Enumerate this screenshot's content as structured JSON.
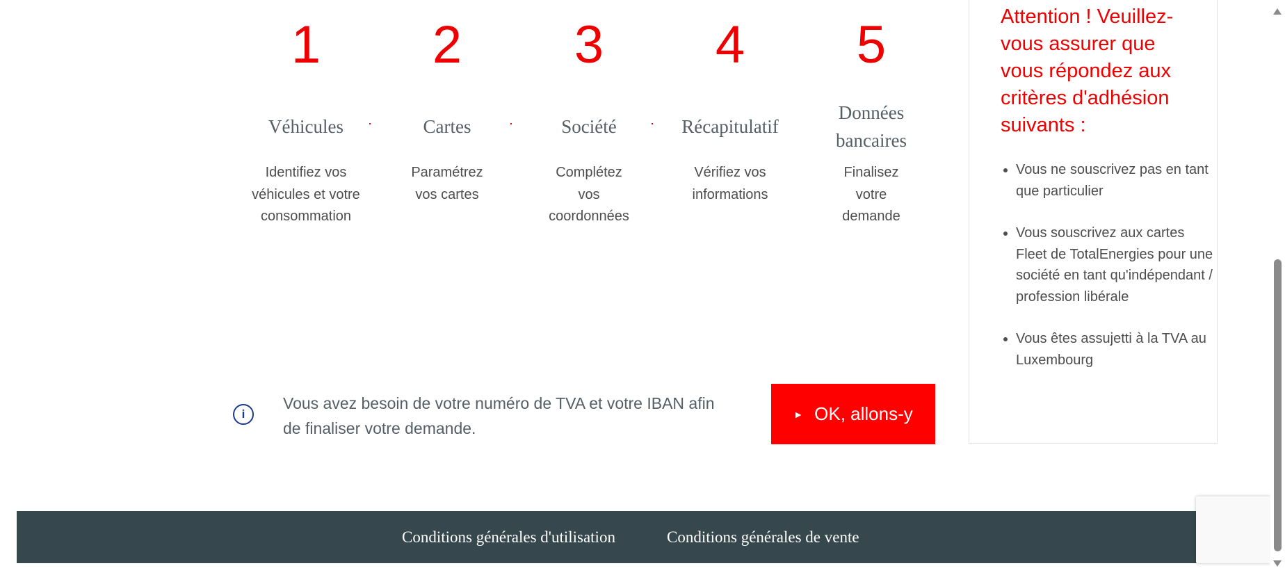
{
  "steps": [
    {
      "number": "1",
      "title": "Véhicules",
      "description": "Identifiez vos véhicules et votre consommation"
    },
    {
      "number": "2",
      "title": "Cartes",
      "description": "Paramétrez vos cartes"
    },
    {
      "number": "3",
      "title": "Société",
      "description": "Complétez vos coordonnées"
    },
    {
      "number": "4",
      "title": "Récapitulatif",
      "description": "Vérifiez vos informations"
    },
    {
      "number": "5",
      "title": "Données bancaires",
      "description": "Finalisez votre demande"
    }
  ],
  "info": {
    "icon": "info-icon",
    "glyph": "i",
    "text": "Vous avez besoin de votre numéro de TVA et votre IBAN afin de finaliser votre demande."
  },
  "cta": {
    "label": "OK, allons-y",
    "arrow": "►"
  },
  "panel": {
    "title": "Attention ! Veuillez-vous assurer que vous répondez aux critères d'adhésion suivants :",
    "criteria": [
      "Vous ne souscrivez pas en tant que particulier",
      "Vous souscrivez aux cartes Fleet de TotalEnergies pour une société en tant qu'indépendant / profession libérale",
      "Vous êtes assujetti à la TVA au Luxembourg"
    ]
  },
  "footer": {
    "links": [
      "Conditions générales d'utilisation",
      "Conditions générales de vente"
    ]
  },
  "colors": {
    "accent": "#ff0000",
    "footer_bg": "#36474d",
    "info_blue": "#1a3a8f",
    "text_gray": "#555f66"
  }
}
